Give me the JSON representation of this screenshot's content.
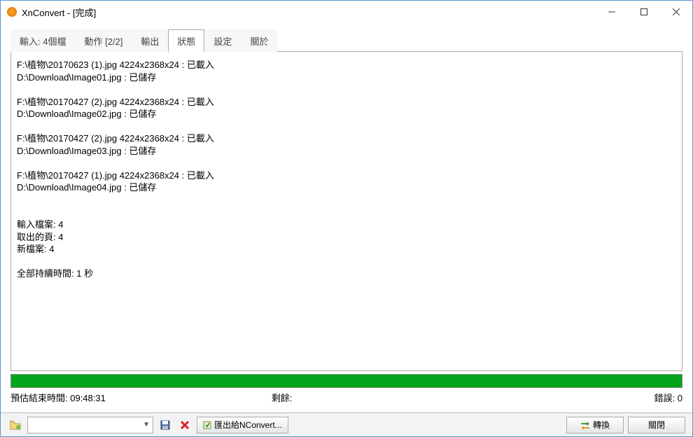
{
  "titlebar": {
    "title": "XnConvert - [完成]"
  },
  "tabs": {
    "input": "輸入: 4個檔",
    "actions": "動作 [2/2]",
    "output": "輸出",
    "status": "狀態",
    "settings": "設定",
    "about": "關於"
  },
  "log": {
    "lines": [
      "F:\\植物\\20170623 (1).jpg 4224x2368x24 : 已載入",
      "D:\\Download\\Image01.jpg : 已儲存",
      "",
      "F:\\植物\\20170427 (2).jpg 4224x2368x24 : 已載入",
      "D:\\Download\\Image02.jpg : 已儲存",
      "",
      "F:\\植物\\20170427 (2).jpg 4224x2368x24 : 已載入",
      "D:\\Download\\Image03.jpg : 已儲存",
      "",
      "F:\\植物\\20170427 (1).jpg 4224x2368x24 : 已載入",
      "D:\\Download\\Image04.jpg : 已儲存",
      "",
      "",
      "輸入檔案: 4",
      "取出的頁: 4",
      "新檔案: 4",
      "",
      "全部持續時間:  1 秒"
    ]
  },
  "status": {
    "est_label": "預估結束時間: ",
    "est_value": "09:48:31",
    "remain_label": "剩餘:",
    "errors_label": "錯誤: ",
    "errors_value": "0"
  },
  "bottom": {
    "export_label": "匯出給NConvert...",
    "convert_label": "轉換",
    "close_label": "關閉"
  }
}
